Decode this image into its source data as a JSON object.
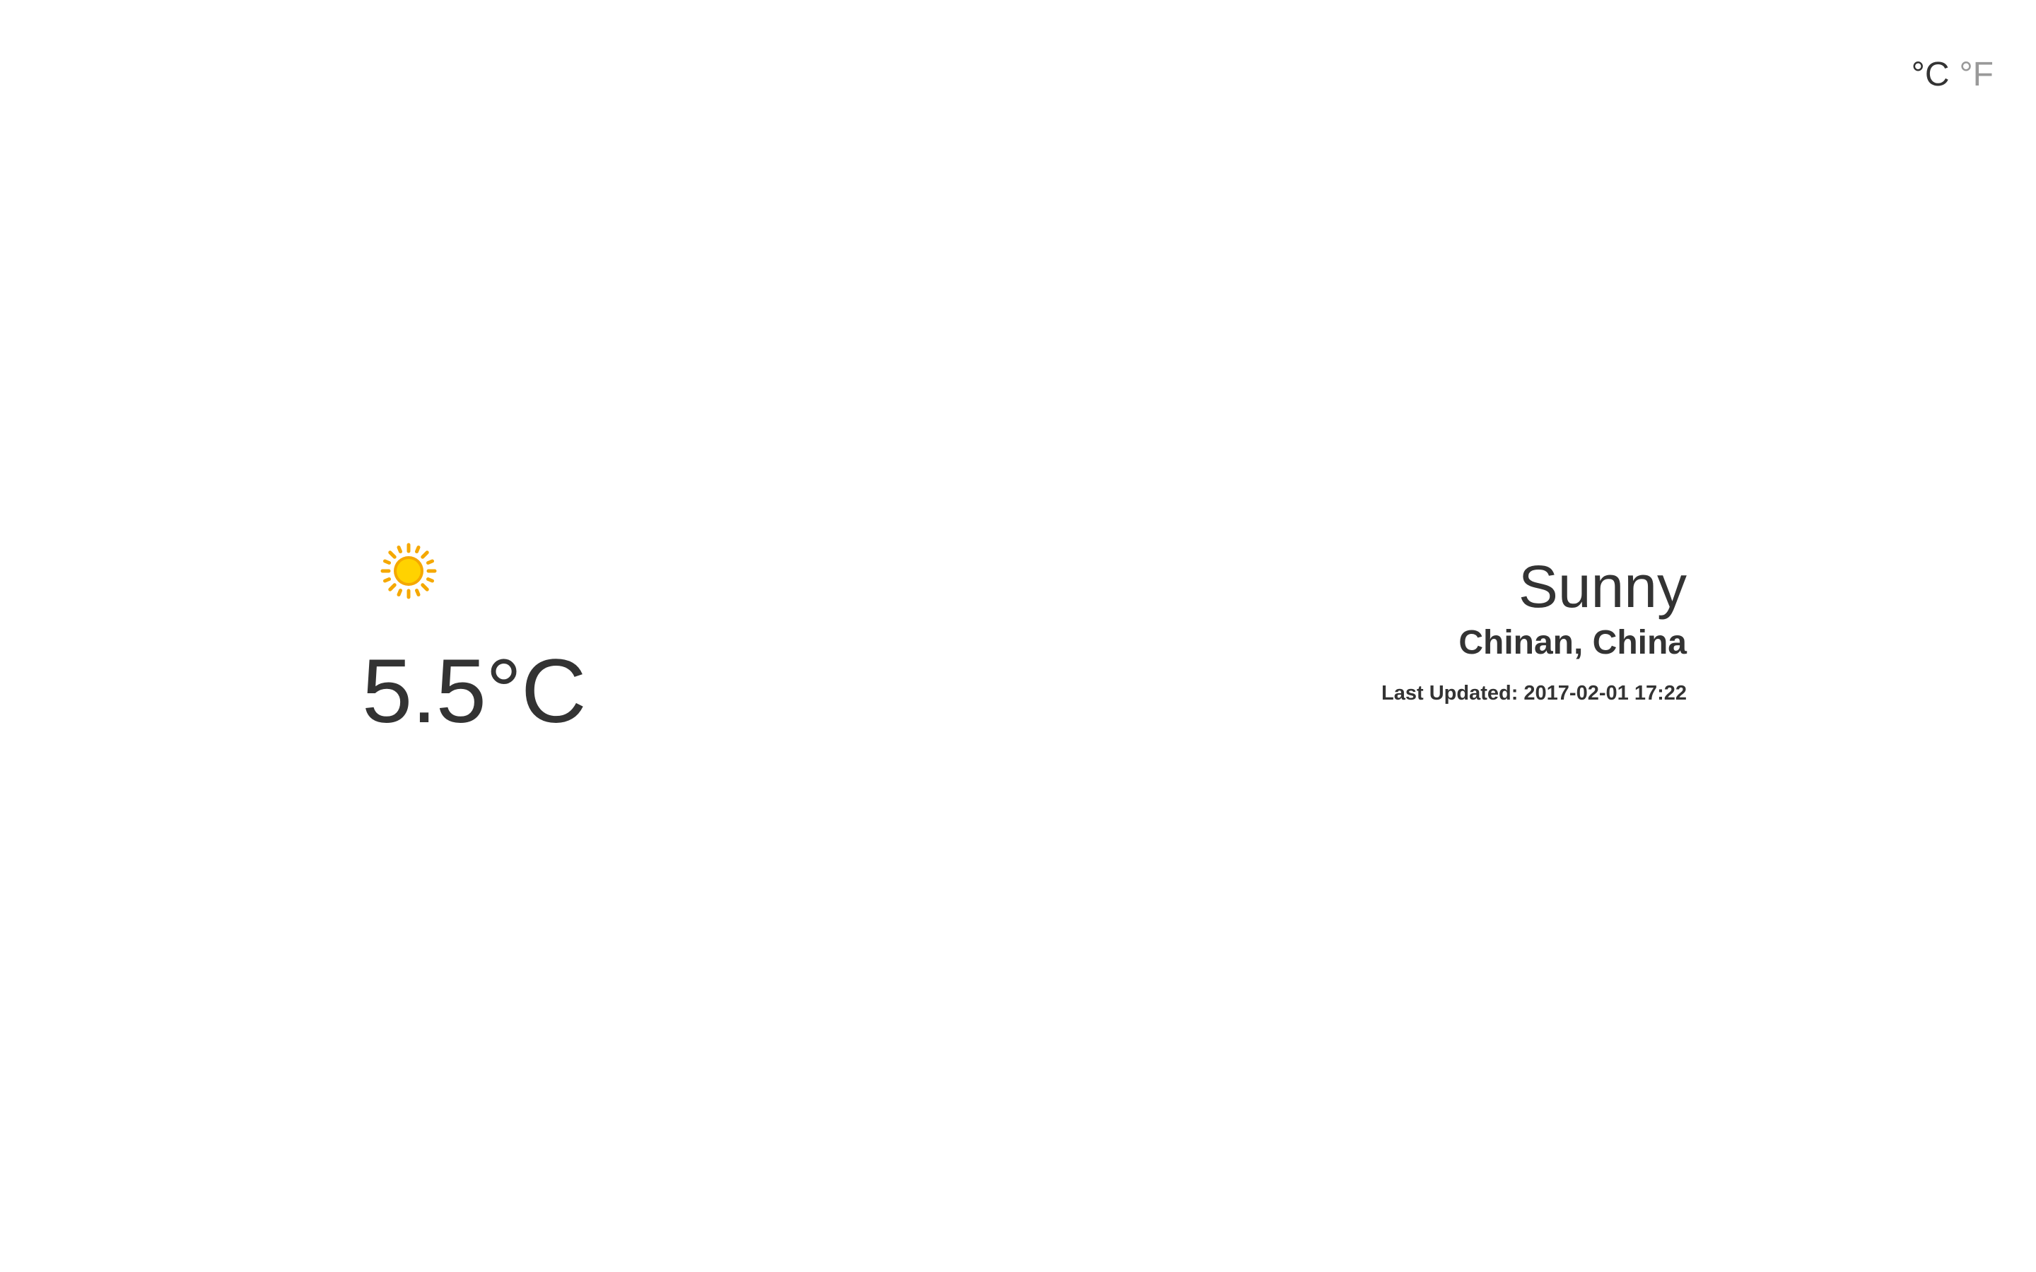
{
  "units": {
    "celsius_label": "°C",
    "fahrenheit_label": "°F",
    "active": "celsius"
  },
  "current": {
    "icon": "sun-icon",
    "temperature": "5.5°C",
    "condition": "Sunny",
    "location": "Chinan, China",
    "last_updated": "Last Updated: 2017-02-01 17:22"
  },
  "colors": {
    "text": "#333333",
    "inactive_unit": "#999999",
    "sun_core": "#FFD200",
    "sun_rays": "#F5A800"
  }
}
